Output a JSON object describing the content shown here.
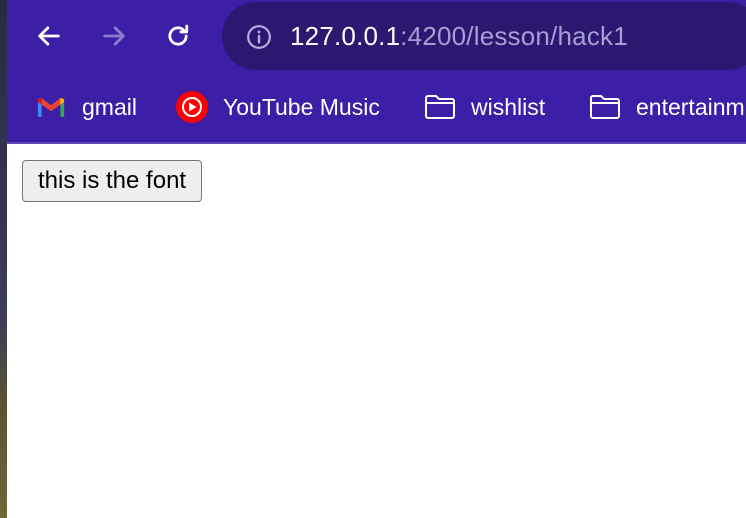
{
  "browser": {
    "url_host": "127.0.0.1",
    "url_path": ":4200/lesson/hack1",
    "icons": {
      "back": "back-arrow-icon",
      "forward": "forward-arrow-icon",
      "reload": "reload-icon",
      "info": "info-icon"
    },
    "colors": {
      "toolbar": "#3c1fa6",
      "omnibox": "#2b1870"
    }
  },
  "bookmarks": [
    {
      "label": "gmail",
      "icon": "gmail-icon"
    },
    {
      "label": "YouTube Music",
      "icon": "youtube-music-icon"
    },
    {
      "label": "wishlist",
      "icon": "folder-icon"
    },
    {
      "label": "entertainm",
      "icon": "folder-icon"
    }
  ],
  "page": {
    "button_label": "this is the font"
  }
}
